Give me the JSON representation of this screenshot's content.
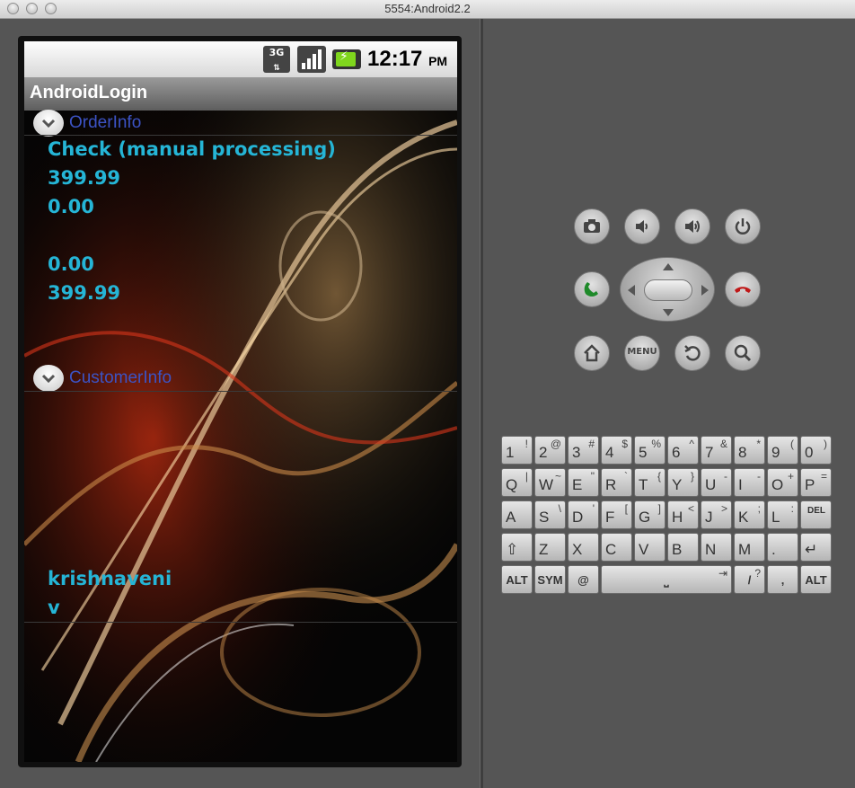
{
  "window": {
    "title": "5554:Android2.2"
  },
  "status_bar": {
    "network": "3G",
    "time": "12:17",
    "ampm": "PM"
  },
  "app": {
    "title": "AndroidLogin"
  },
  "order_info": {
    "label": "OrderInfo",
    "values": [
      "Check (manual processing)",
      "399.99",
      "0.00",
      "",
      "0.00",
      "399.99"
    ]
  },
  "customer_info": {
    "label": "CustomerInfo",
    "values": [
      "krishnaveni",
      "v"
    ]
  },
  "controls": {
    "menu_label": "MENU"
  },
  "keyboard": {
    "rows": [
      [
        {
          "m": "1",
          "s": "!"
        },
        {
          "m": "2",
          "s": "@"
        },
        {
          "m": "3",
          "s": "#"
        },
        {
          "m": "4",
          "s": "$"
        },
        {
          "m": "5",
          "s": "%"
        },
        {
          "m": "6",
          "s": "^"
        },
        {
          "m": "7",
          "s": "&"
        },
        {
          "m": "8",
          "s": "*"
        },
        {
          "m": "9",
          "s": "("
        },
        {
          "m": "0",
          "s": ")"
        }
      ],
      [
        {
          "m": "Q",
          "s": "|"
        },
        {
          "m": "W",
          "s": "~"
        },
        {
          "m": "E",
          "s": "\""
        },
        {
          "m": "R",
          "s": "`"
        },
        {
          "m": "T",
          "s": "{"
        },
        {
          "m": "Y",
          "s": "}"
        },
        {
          "m": "U",
          "s": "-"
        },
        {
          "m": "I",
          "s": "-"
        },
        {
          "m": "O",
          "s": "+"
        },
        {
          "m": "P",
          "s": "="
        }
      ],
      [
        {
          "m": "A",
          "s": ""
        },
        {
          "m": "S",
          "s": "\\"
        },
        {
          "m": "D",
          "s": "'"
        },
        {
          "m": "F",
          "s": "["
        },
        {
          "m": "G",
          "s": "]"
        },
        {
          "m": "H",
          "s": "<"
        },
        {
          "m": "J",
          "s": ">"
        },
        {
          "m": "K",
          "s": ";"
        },
        {
          "m": "L",
          "s": ":"
        },
        {
          "m": "DEL",
          "s": ""
        }
      ],
      [
        {
          "m": "⇧",
          "s": ""
        },
        {
          "m": "Z",
          "s": ""
        },
        {
          "m": "X",
          "s": ""
        },
        {
          "m": "C",
          "s": ""
        },
        {
          "m": "V",
          "s": ""
        },
        {
          "m": "B",
          "s": ""
        },
        {
          "m": "N",
          "s": ""
        },
        {
          "m": "M",
          "s": ""
        },
        {
          "m": ".",
          "s": ""
        },
        {
          "m": "↵",
          "s": ""
        }
      ]
    ],
    "bottom_row": {
      "alt_left": "ALT",
      "sym": "SYM",
      "at": "@",
      "space": "⎵",
      "tab": "⇥",
      "slash": "/",
      "question": "?",
      "comma": ",",
      "alt_right": "ALT"
    }
  }
}
